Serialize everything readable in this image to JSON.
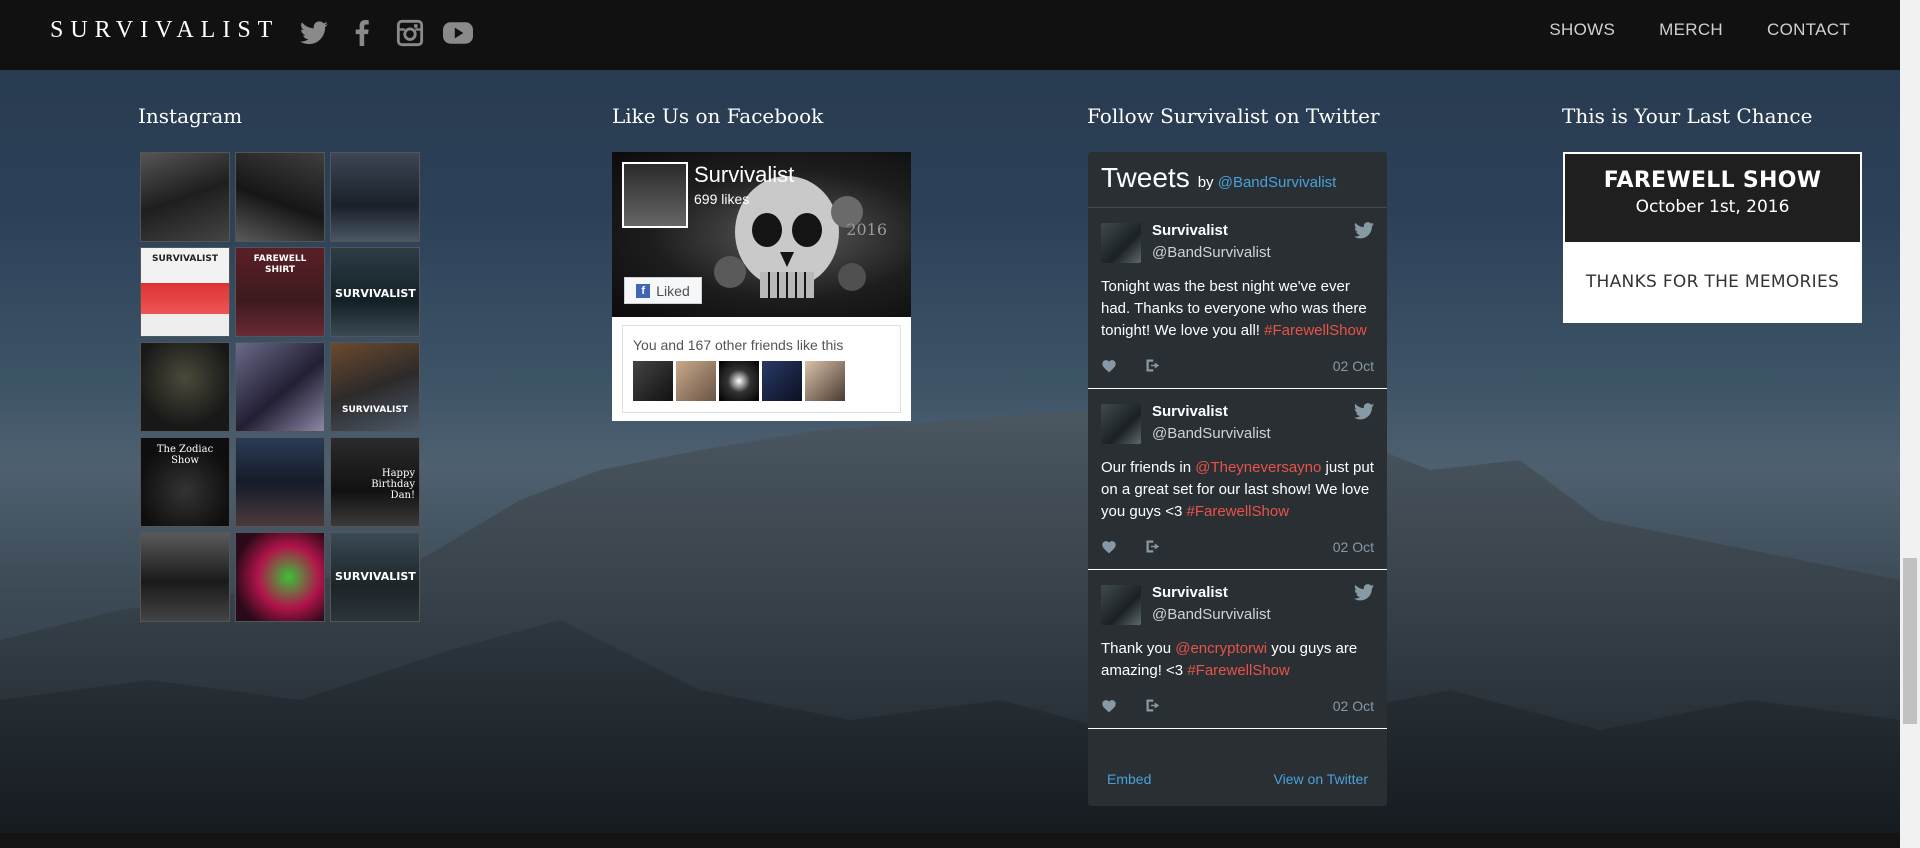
{
  "header": {
    "logo_text": "SURVIVALIST",
    "social": [
      "twitter-icon",
      "facebook-icon",
      "instagram-icon",
      "youtube-icon"
    ],
    "nav": [
      "SHOWS",
      "MERCH",
      "CONTACT"
    ]
  },
  "instagram": {
    "title": "Instagram",
    "tiles": [
      {
        "caption": ""
      },
      {
        "caption": ""
      },
      {
        "caption": ""
      },
      {
        "caption": "SURVIVALIST"
      },
      {
        "caption": "FAREWELL SHIRT"
      },
      {
        "caption": "SURVIVALIST"
      },
      {
        "caption": ""
      },
      {
        "caption": ""
      },
      {
        "caption": "SURVIVALIST"
      },
      {
        "caption": "The Zodiac Show"
      },
      {
        "caption": ""
      },
      {
        "caption": "Happy Birthday Dan!"
      },
      {
        "caption": ""
      },
      {
        "caption": ""
      },
      {
        "caption": "SURVIVALIST"
      }
    ]
  },
  "facebook": {
    "title": "Like Us on Facebook",
    "page_name": "Survivalist",
    "likes": "699 likes",
    "liked_label": "Liked",
    "friends_text": "You and 167 other friends like this",
    "year": "2016"
  },
  "twitter": {
    "title": "Follow Survivalist on Twitter",
    "widget_title": "Tweets",
    "by_label": "by",
    "account": "@BandSurvivalist",
    "tweets": [
      {
        "name": "Survivalist",
        "handle": "@BandSurvivalist",
        "text_parts": [
          {
            "t": "Tonight was the best night we've ever had. Thanks to everyone who was there tonight! We love you all! ",
            "hl": false
          },
          {
            "t": "#FarewellShow",
            "hl": true
          }
        ],
        "date": "02 Oct"
      },
      {
        "name": "Survivalist",
        "handle": "@BandSurvivalist",
        "text_parts": [
          {
            "t": "Our friends in ",
            "hl": false
          },
          {
            "t": "@Theyneversayno",
            "hl": true
          },
          {
            "t": " just put on a great set for our last show! We love you guys <3 ",
            "hl": false
          },
          {
            "t": "#FarewellShow",
            "hl": true
          }
        ],
        "date": "02 Oct"
      },
      {
        "name": "Survivalist",
        "handle": "@BandSurvivalist",
        "text_parts": [
          {
            "t": "Thank you ",
            "hl": false
          },
          {
            "t": "@encryptorwi",
            "hl": true
          },
          {
            "t": " you guys are amazing! <3 ",
            "hl": false
          },
          {
            "t": "#FarewellShow",
            "hl": true
          }
        ],
        "date": "02 Oct"
      }
    ],
    "embed_label": "Embed",
    "view_label": "View on Twitter"
  },
  "last_chance": {
    "title": "This is Your Last Chance",
    "show_title": "FAREWELL SHOW",
    "show_date": "October 1st, 2016",
    "message": "THANKS FOR THE MEMORIES"
  },
  "colors": {
    "link": "#4aa1d8",
    "highlight": "#e8534a",
    "widget_bg": "#292f33"
  }
}
